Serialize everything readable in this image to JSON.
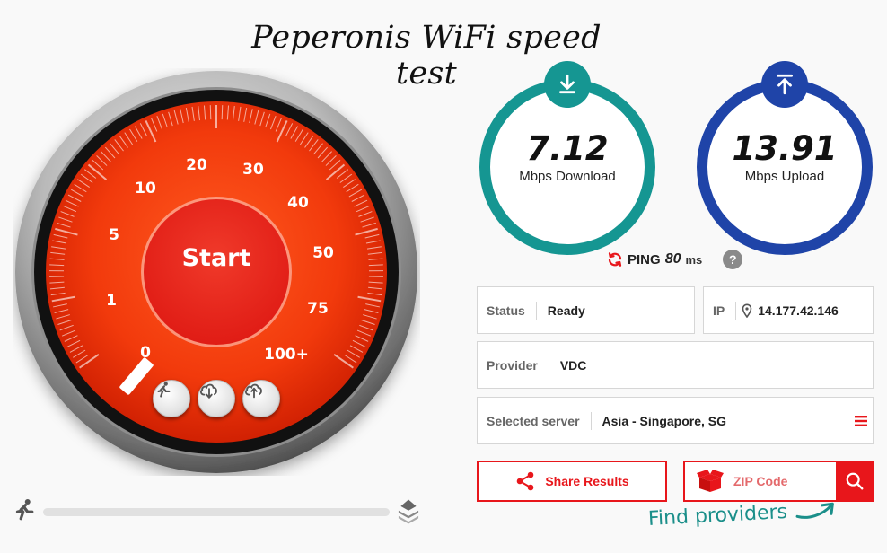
{
  "page_title": "Peperonis WiFi speed test",
  "gauge": {
    "start_label": "Start",
    "ticks": [
      "0",
      "1",
      "5",
      "10",
      "20",
      "30",
      "40",
      "50",
      "75",
      "100+"
    ],
    "buttons": [
      {
        "icon": "running-person-icon"
      },
      {
        "icon": "cloud-download-icon"
      },
      {
        "icon": "cloud-upload-icon"
      }
    ]
  },
  "progress": {
    "left_icon": "running-person-icon",
    "right_icon": "layers-icon",
    "value": 0
  },
  "download": {
    "value": "7.12",
    "unit": "Mbps Download",
    "icon": "download-arrow-icon",
    "color": "#159692"
  },
  "upload": {
    "value": "13.91",
    "unit": "Mbps Upload",
    "icon": "upload-arrow-icon",
    "color": "#1f44a8"
  },
  "ping": {
    "label": "PING",
    "value": "80",
    "unit": "ms",
    "help": "?"
  },
  "info": {
    "status_label": "Status",
    "status_value": "Ready",
    "ip_label": "IP",
    "ip_value": "14.177.42.146",
    "provider_label": "Provider",
    "provider_value": "VDC",
    "server_label": "Selected server",
    "server_value": "Asia - Singapore, SG"
  },
  "actions": {
    "share_label": "Share Results",
    "zip_placeholder": "ZIP Code",
    "find_label": "Find providers"
  },
  "colors": {
    "accent_red": "#e8161b",
    "teal": "#159692",
    "blue": "#1f44a8"
  }
}
